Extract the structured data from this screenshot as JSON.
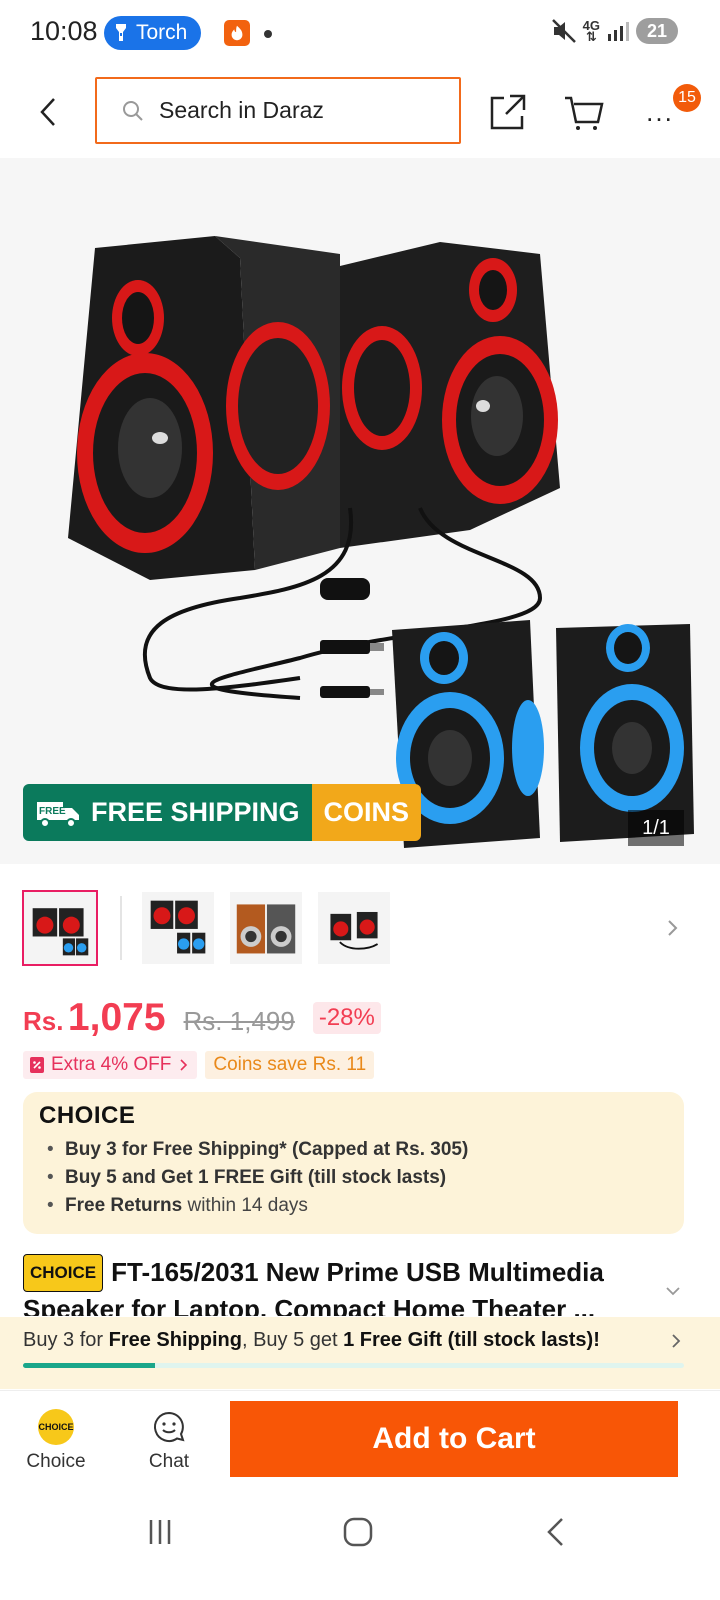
{
  "status_bar": {
    "time": "10:08",
    "torch_label": "Torch",
    "network": "4G",
    "battery": "21"
  },
  "header": {
    "search_placeholder": "Search in Daraz",
    "cart_badge": "15",
    "more_label": "..."
  },
  "hero": {
    "banner_free_shipping": "FREE SHIPPING",
    "banner_free_tag": "FREE",
    "banner_coins": "COINS",
    "image_counter": "1/1"
  },
  "price": {
    "currency": "Rs.",
    "current": "1,075",
    "original": "Rs. 1,499",
    "discount": "-28%"
  },
  "promos": {
    "extra_off": "Extra 4% OFF",
    "coins_save": "Coins save Rs. 11"
  },
  "choice": {
    "logo": "CHOICE",
    "items": [
      {
        "bold": "Buy 3 for  Free Shipping* (Capped at Rs. 305)",
        "rest": ""
      },
      {
        "bold": "Buy 5 and Get 1 FREE Gift (till stock lasts)",
        "rest": ""
      },
      {
        "bold": "Free Returns",
        "rest": " within 14 days"
      }
    ]
  },
  "product": {
    "chip": "CHOICE",
    "title": "FT-165/2031 New Prime USB Multimedia Speaker for Laptop, Compact Home Theater ..."
  },
  "promo_strip": {
    "part1": "Buy 3 for ",
    "bold1": "Free Shipping",
    "part2": ", Buy 5 get ",
    "bold2": "1 Free Gift (till stock lasts)!",
    "progress": 0.2
  },
  "bottom_bar": {
    "choice_label": "Choice",
    "choice_icon_text": "CHOICE",
    "chat_label": "Chat",
    "add_to_cart": "Add to Cart"
  },
  "colors": {
    "accent_orange": "#f85606",
    "price_red": "#f23d52",
    "choice_yellow": "#f7c81a",
    "shipping_green": "#0b7a5c"
  }
}
